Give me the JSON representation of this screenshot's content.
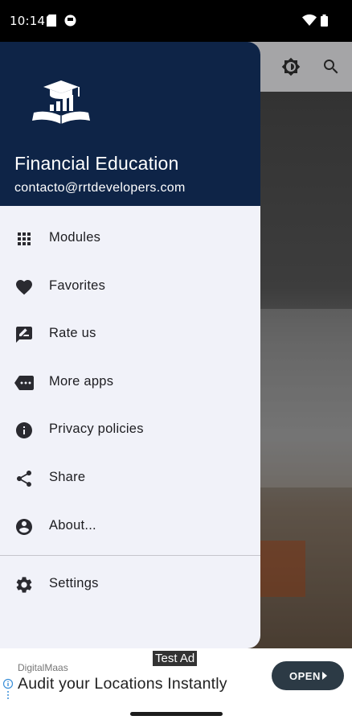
{
  "status_bar": {
    "time": "10:14",
    "icons": [
      "sd-card-icon",
      "app-notification-icon",
      "wifi-icon",
      "battery-icon"
    ]
  },
  "toolbar": {
    "icons": [
      "brightness-icon",
      "search-icon"
    ]
  },
  "drawer": {
    "title": "Financial Education",
    "email": "contacto@rrtdevelopers.com",
    "items": [
      {
        "label": "Modules",
        "icon": "grid-icon"
      },
      {
        "label": "Favorites",
        "icon": "heart-icon"
      },
      {
        "label": "Rate us",
        "icon": "rate-review-icon"
      },
      {
        "label": "More apps",
        "icon": "more-apps-icon"
      },
      {
        "label": "Privacy policies",
        "icon": "info-icon"
      },
      {
        "label": "Share",
        "icon": "share-icon"
      },
      {
        "label": "About...",
        "icon": "account-circle-icon"
      }
    ],
    "settings": {
      "label": "Settings",
      "icon": "gear-icon"
    }
  },
  "ad": {
    "badge": "Test Ad",
    "advertiser": "DigitalMaas",
    "headline": "Audit your Locations Instantly",
    "cta": "OPEN"
  },
  "colors": {
    "header_bg": "#0e2447",
    "drawer_bg": "#f1f2f9",
    "cta_bg": "#2c3a45"
  }
}
